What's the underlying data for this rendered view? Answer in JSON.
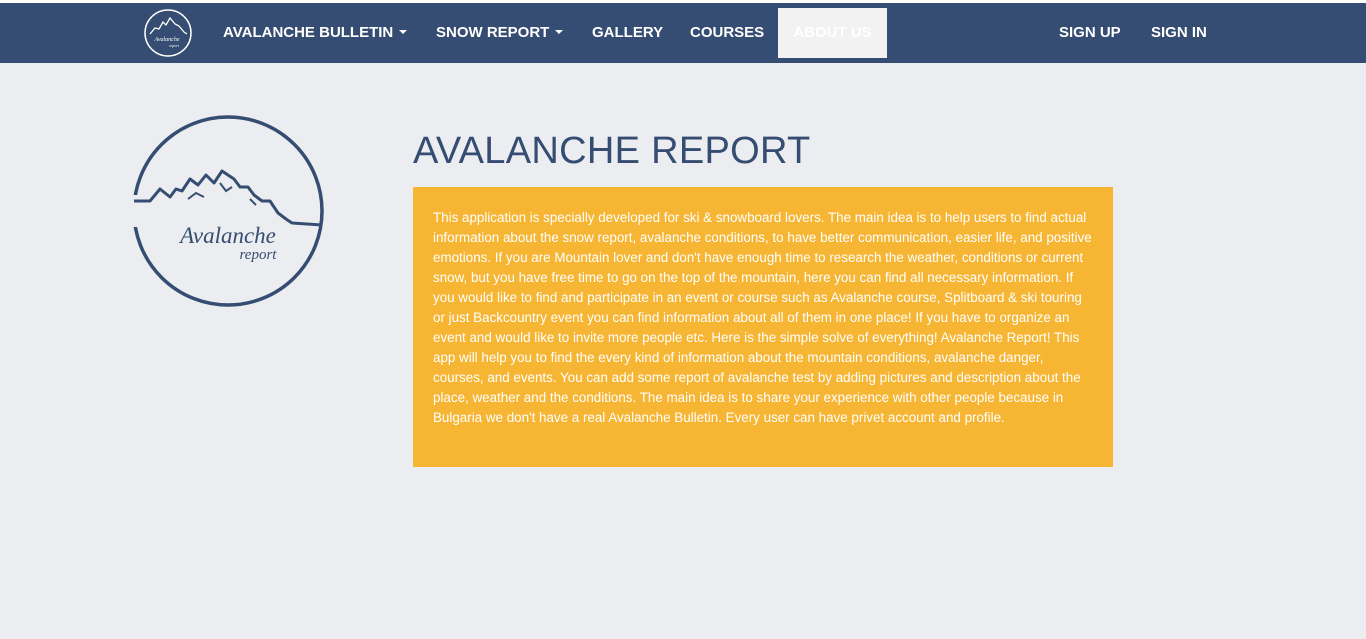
{
  "nav": {
    "items": [
      {
        "label": "AVALANCHE BULLETIN",
        "dropdown": true
      },
      {
        "label": "SNOW REPORT",
        "dropdown": true
      },
      {
        "label": "GALLERY",
        "dropdown": false
      },
      {
        "label": "COURSES",
        "dropdown": false
      },
      {
        "label": "ABOUT US",
        "dropdown": false,
        "active": true
      }
    ],
    "sign_up": "SIGN UP",
    "sign_in": "SIGN IN"
  },
  "logo": {
    "line1": "Avalanche",
    "line2": "report"
  },
  "main": {
    "title": "AVALANCHE REPORT",
    "description": "This application is specially developed for ski & snowboard lovers. The main idea is to help users to find actual information about the snow report, avalanche conditions, to have better communication, easier life, and positive emotions. If you are Mountain lover and don't have enough time to research the weather, conditions or current snow, but you have free time to go on the top of the mountain, here you can find all necessary information. If you would like to find and participate in an event or course such as Avalanche course, Splitboard & ski touring or just Backcountry event you can find information about all of them in one place! If you have to organize an event and would like to invite more people etc. Here is the simple solve of everything! Avalanche Report! This app will help you to find the every kind of information about the mountain conditions, avalanche danger, courses, and events. You can add some report of avalanche test by adding pictures and description about the place, weather and the conditions. The main idea is to share your experience with other people because in Bulgaria we don't have a real Avalanche Bulletin. Every user can have privet account and profile."
  },
  "colors": {
    "navbar": "#354d72",
    "background": "#ecedf0",
    "accent": "#f6b533",
    "active_tab": "#f2f2f2"
  }
}
